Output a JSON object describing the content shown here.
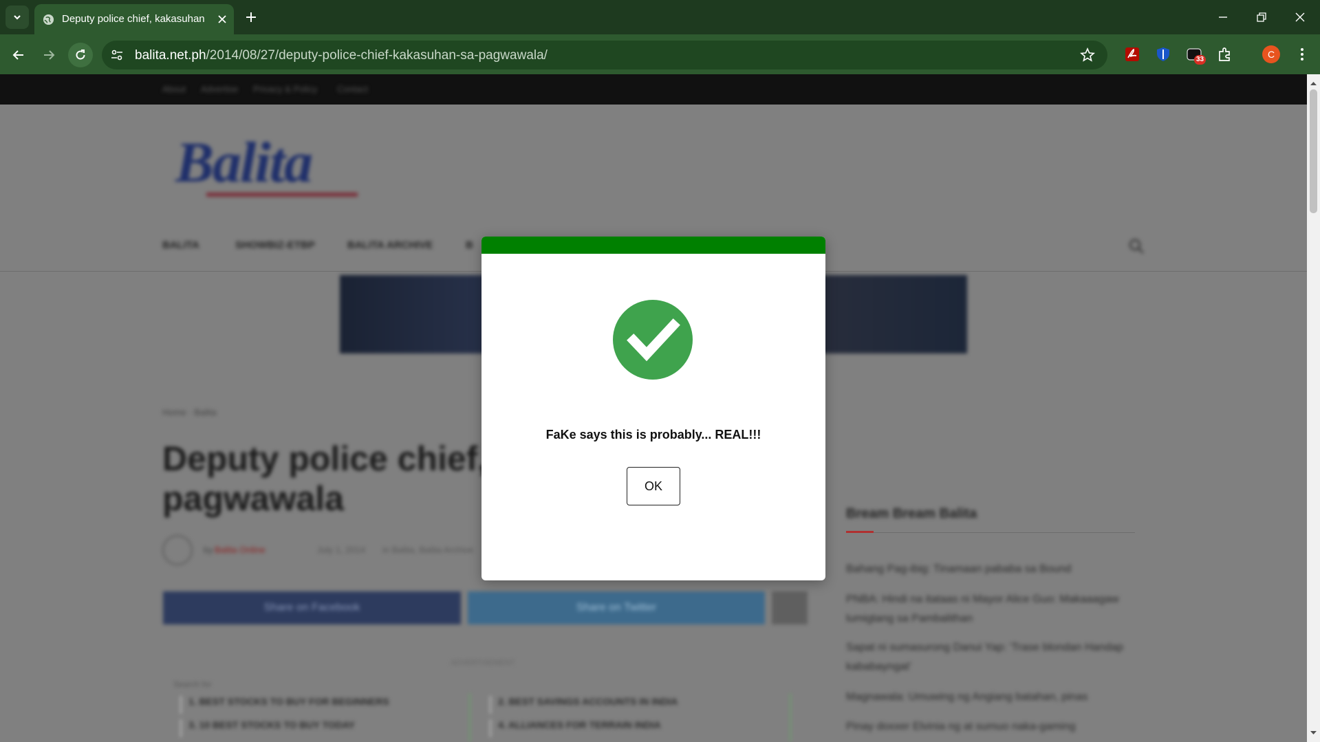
{
  "browser": {
    "tab_title": "Deputy police chief, kakasuhan",
    "url_host": "balita.net.ph",
    "url_path": "/2014/08/27/deputy-police-chief-kakasuhan-sa-pagwawala/",
    "extension_badge": "33",
    "profile_initial": "C",
    "theme_colors": {
      "frame": "#1e3a1f",
      "toolbar": "#2e5a2f",
      "omnibox": "#1f4721"
    }
  },
  "page": {
    "top_links": [
      "About",
      "Advertise",
      "Privacy & Policy",
      "Contact"
    ],
    "logo_text": "Balita",
    "nav_items": [
      "BALITA",
      "SHOWBIZ-ETBP",
      "BALITA ARCHIVE",
      "B"
    ],
    "breadcrumb": "Home · Balita",
    "article_title": "Deputy police chief, pagwawala",
    "author_by": "by",
    "author_name": "Balita Online",
    "date": "July 1, 2014",
    "categories": "in Balita, Balita Archive",
    "share_facebook": "Share on Facebook",
    "share_twitter": "Share on Twitter",
    "advertisement_label": "ADVERTISEMENT",
    "sponsored_label": "Search for",
    "ad_links": [
      "1. BEST STOCKS TO BUY FOR BEGINNERS",
      "2. BEST SAVINGS ACCOUNTS IN INDIA",
      "3. 10 BEST STOCKS TO BUY TODAY",
      "4. ALLIANCES FOR TERRAIN INDIA"
    ],
    "sidebar_title": "Bream Bream Balita",
    "sidebar_items": [
      "Bahang Pag-ibig: Tinamaan pababa sa Bound",
      "PNBA: Hindi na itataas ni Mayor Alice Guo: Makaaagaw lumigtang sa Pambalithan",
      "Sapat ni sumasurong Danui Yap: 'Trase blondan Handap kababayngat'",
      "Magnawala: Umuwing ng Angiang batahan, pinas",
      "Pinay doxxer Elvinia ng at sumuo naka-gaming"
    ]
  },
  "modal": {
    "accent_color": "#008000",
    "check_color": "#3fa34d",
    "message": "FaKe says this is probably... REAL!!!",
    "ok_label": "OK"
  }
}
